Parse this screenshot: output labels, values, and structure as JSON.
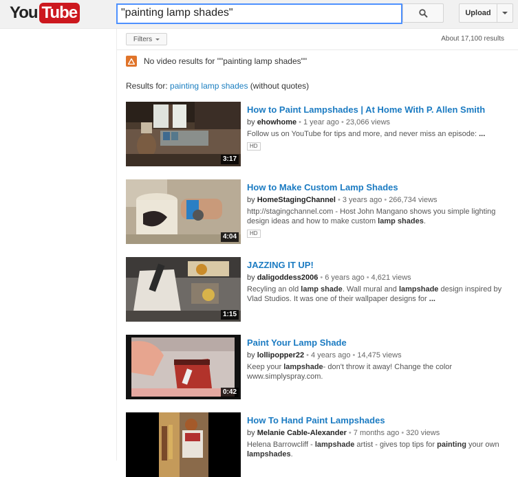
{
  "header": {
    "logo_you": "You",
    "logo_tube": "Tube",
    "search_value": "\"painting lamp shades\"",
    "upload_label": "Upload"
  },
  "filters_label": "Filters",
  "result_count": "About 17,100 results",
  "notice": "No video results for \"\"painting lamp shades\"\"",
  "results_for": {
    "prefix": "Results for:",
    "query_link": "painting lamp shades",
    "suffix": "(without quotes)"
  },
  "results": [
    {
      "title": "How to Paint Lampshades | At Home With P. Allen Smith",
      "by": "by",
      "channel": "ehowhome",
      "age": "1 year ago",
      "views": "23,066 views",
      "desc_html": "Follow us on YouTube for tips and more, and never miss an episode: <b>...</b>",
      "hd": "HD",
      "duration": "3:17"
    },
    {
      "title": "How to Make Custom Lamp Shades",
      "by": "by",
      "channel": "HomeStagingChannel",
      "age": "3 years ago",
      "views": "266,734 views",
      "desc_html": "http://stagingchannel.com - Host John Mangano shows you simple lighting design ideas and how to make custom <b>lamp shades</b>.",
      "hd": "HD",
      "duration": "4:04"
    },
    {
      "title": "JAZZING IT UP!",
      "by": "by",
      "channel": "daligoddess2006",
      "age": "6 years ago",
      "views": "4,621 views",
      "desc_html": "Recyling an old <b>lamp shade</b>. Wall mural and <b>lampshade</b> design inspired by Vlad Studios. It was one of their wallpaper designs for <b>...</b>",
      "hd": "",
      "duration": "1:15"
    },
    {
      "title": "Paint Your Lamp Shade",
      "by": "by",
      "channel": "lollipopper22",
      "age": "4 years ago",
      "views": "14,475 views",
      "desc_html": "Keep your <b>lampshade</b>- don't throw it away! Change the color www.simplyspray.com.",
      "hd": "",
      "duration": "0:42"
    },
    {
      "title": "How To Hand Paint Lampshades",
      "by": "by",
      "channel": "Melanie Cable-Alexander",
      "age": "7 months ago",
      "views": "320 views",
      "desc_html": "Helena Barrowcliff - <b>lampshade</b> artist - gives top tips for <b>painting</b> your own <b>lampshades</b>.",
      "hd": "",
      "duration": ""
    }
  ]
}
